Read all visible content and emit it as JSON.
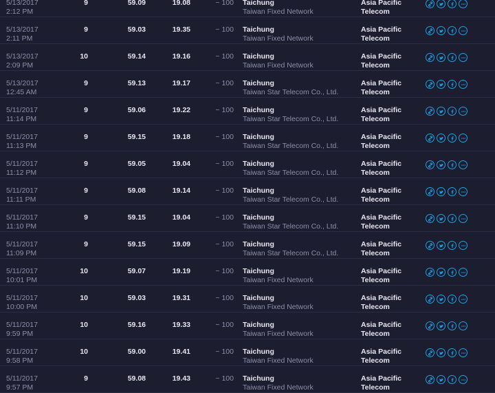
{
  "rows": [
    {
      "date": "5/13/2017",
      "time": "2:12 PM",
      "ping": "9",
      "download": "59.09",
      "upload": "19.08",
      "distance": "~ 100",
      "city": "Taichung",
      "isp": "Taiwan Fixed Network",
      "host_line1": "Asia Pacific",
      "host_line2": "Telecom"
    },
    {
      "date": "5/13/2017",
      "time": "2:11 PM",
      "ping": "9",
      "download": "59.03",
      "upload": "19.35",
      "distance": "~ 100",
      "city": "Taichung",
      "isp": "Taiwan Fixed Network",
      "host_line1": "Asia Pacific",
      "host_line2": "Telecom"
    },
    {
      "date": "5/13/2017",
      "time": "2:09 PM",
      "ping": "10",
      "download": "59.14",
      "upload": "19.16",
      "distance": "~ 100",
      "city": "Taichung",
      "isp": "Taiwan Fixed Network",
      "host_line1": "Asia Pacific",
      "host_line2": "Telecom"
    },
    {
      "date": "5/13/2017",
      "time": "12:45 AM",
      "ping": "9",
      "download": "59.13",
      "upload": "19.17",
      "distance": "~ 100",
      "city": "Taichung",
      "isp": "Taiwan Star Telecom Co., Ltd.",
      "host_line1": "Asia Pacific",
      "host_line2": "Telecom"
    },
    {
      "date": "5/11/2017",
      "time": "11:14 PM",
      "ping": "9",
      "download": "59.06",
      "upload": "19.22",
      "distance": "~ 100",
      "city": "Taichung",
      "isp": "Taiwan Star Telecom Co., Ltd.",
      "host_line1": "Asia Pacific",
      "host_line2": "Telecom"
    },
    {
      "date": "5/11/2017",
      "time": "11:13 PM",
      "ping": "9",
      "download": "59.15",
      "upload": "19.18",
      "distance": "~ 100",
      "city": "Taichung",
      "isp": "Taiwan Star Telecom Co., Ltd.",
      "host_line1": "Asia Pacific",
      "host_line2": "Telecom"
    },
    {
      "date": "5/11/2017",
      "time": "11:12 PM",
      "ping": "9",
      "download": "59.05",
      "upload": "19.04",
      "distance": "~ 100",
      "city": "Taichung",
      "isp": "Taiwan Star Telecom Co., Ltd.",
      "host_line1": "Asia Pacific",
      "host_line2": "Telecom"
    },
    {
      "date": "5/11/2017",
      "time": "11:11 PM",
      "ping": "9",
      "download": "59.08",
      "upload": "19.14",
      "distance": "~ 100",
      "city": "Taichung",
      "isp": "Taiwan Star Telecom Co., Ltd.",
      "host_line1": "Asia Pacific",
      "host_line2": "Telecom"
    },
    {
      "date": "5/11/2017",
      "time": "11:10 PM",
      "ping": "9",
      "download": "59.15",
      "upload": "19.04",
      "distance": "~ 100",
      "city": "Taichung",
      "isp": "Taiwan Star Telecom Co., Ltd.",
      "host_line1": "Asia Pacific",
      "host_line2": "Telecom"
    },
    {
      "date": "5/11/2017",
      "time": "11:09 PM",
      "ping": "9",
      "download": "59.15",
      "upload": "19.09",
      "distance": "~ 100",
      "city": "Taichung",
      "isp": "Taiwan Star Telecom Co., Ltd.",
      "host_line1": "Asia Pacific",
      "host_line2": "Telecom"
    },
    {
      "date": "5/11/2017",
      "time": "10:01 PM",
      "ping": "10",
      "download": "59.07",
      "upload": "19.19",
      "distance": "~ 100",
      "city": "Taichung",
      "isp": "Taiwan Fixed Network",
      "host_line1": "Asia Pacific",
      "host_line2": "Telecom"
    },
    {
      "date": "5/11/2017",
      "time": "10:00 PM",
      "ping": "10",
      "download": "59.03",
      "upload": "19.31",
      "distance": "~ 100",
      "city": "Taichung",
      "isp": "Taiwan Fixed Network",
      "host_line1": "Asia Pacific",
      "host_line2": "Telecom"
    },
    {
      "date": "5/11/2017",
      "time": "9:59 PM",
      "ping": "10",
      "download": "59.16",
      "upload": "19.33",
      "distance": "~ 100",
      "city": "Taichung",
      "isp": "Taiwan Fixed Network",
      "host_line1": "Asia Pacific",
      "host_line2": "Telecom"
    },
    {
      "date": "5/11/2017",
      "time": "9:58 PM",
      "ping": "10",
      "download": "59.00",
      "upload": "19.41",
      "distance": "~ 100",
      "city": "Taichung",
      "isp": "Taiwan Fixed Network",
      "host_line1": "Asia Pacific",
      "host_line2": "Telecom"
    },
    {
      "date": "5/11/2017",
      "time": "9:57 PM",
      "ping": "9",
      "download": "59.08",
      "upload": "19.43",
      "distance": "~ 100",
      "city": "Taichung",
      "isp": "Taiwan Fixed Network",
      "host_line1": "Asia Pacific",
      "host_line2": "Telecom"
    }
  ],
  "action_icons": [
    "link-icon",
    "twitter-icon",
    "facebook-icon",
    "more-icon"
  ],
  "colors": {
    "background": "#1c1d2f",
    "row_divider": "#2b2d44",
    "primary_text": "#e6e7f0",
    "secondary_text": "#8d8fa8",
    "accent": "#1aa3e8"
  }
}
